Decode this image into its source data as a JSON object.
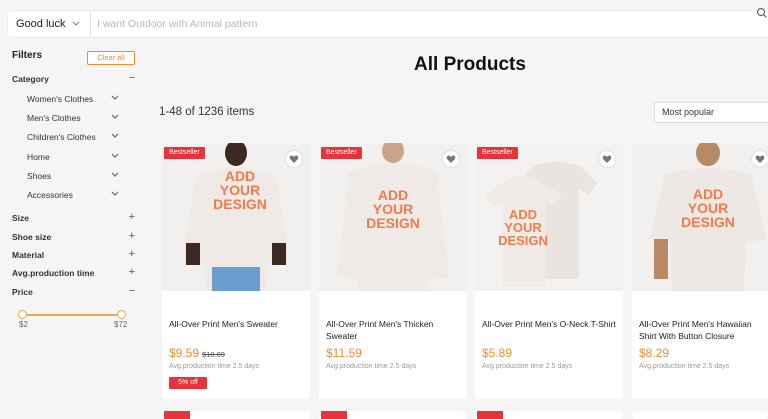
{
  "search": {
    "scope": "Good luck",
    "placeholder": "I want Outdoor with Animal pattern"
  },
  "sidebar": {
    "title": "Filters",
    "clear": "Clear all",
    "category": {
      "label": "Category",
      "sign": "−"
    },
    "category_items": [
      "Women's Clothes",
      "Men's Clothes",
      "Children's Clothes",
      "Home",
      "Shoes",
      "Accessories"
    ],
    "sections": [
      {
        "label": "Size",
        "sign": "+"
      },
      {
        "label": "Shoe size",
        "sign": "+"
      },
      {
        "label": "Material",
        "sign": "+"
      },
      {
        "label": "Avg.production time",
        "sign": "+"
      }
    ],
    "price": {
      "label": "Price",
      "sign": "−",
      "min": "$2",
      "max": "$72"
    }
  },
  "main": {
    "title": "All Products",
    "count": "1-48 of 1236 items",
    "sort": "Most popular"
  },
  "products": [
    {
      "badge": "Bestseller",
      "title": "All-Over Print Men's Sweater",
      "price": "$9.59",
      "old_price": "$10.09",
      "avg": "Avg.production time 2.5 days",
      "discount": "5% off"
    },
    {
      "badge": "Bestseller",
      "title": "All-Over Print Men's Thicken Sweater",
      "price": "$11.59",
      "avg": "Avg.production time 2.5 days"
    },
    {
      "badge": "Bestseller",
      "title": "All-Over Print Men's O-Neck T-Shirt",
      "price": "$5.89",
      "avg": "Avg.production time 2.5 days"
    },
    {
      "title": "All-Over Print Men's Hawaiian Shirt With Button Closure",
      "price": "$8.29",
      "avg": "Avg.production time 2.5 days"
    }
  ],
  "design_text": {
    "line1": "ADD",
    "line2": "YOUR",
    "line3": "DESIGN"
  },
  "colors": {
    "accent": "#f28b2c",
    "badge": "#e8333a",
    "design": "#f07b4f"
  },
  "icons": {
    "search": "search-icon",
    "heart": "heart-icon",
    "chevron": "chevron-down-icon"
  }
}
